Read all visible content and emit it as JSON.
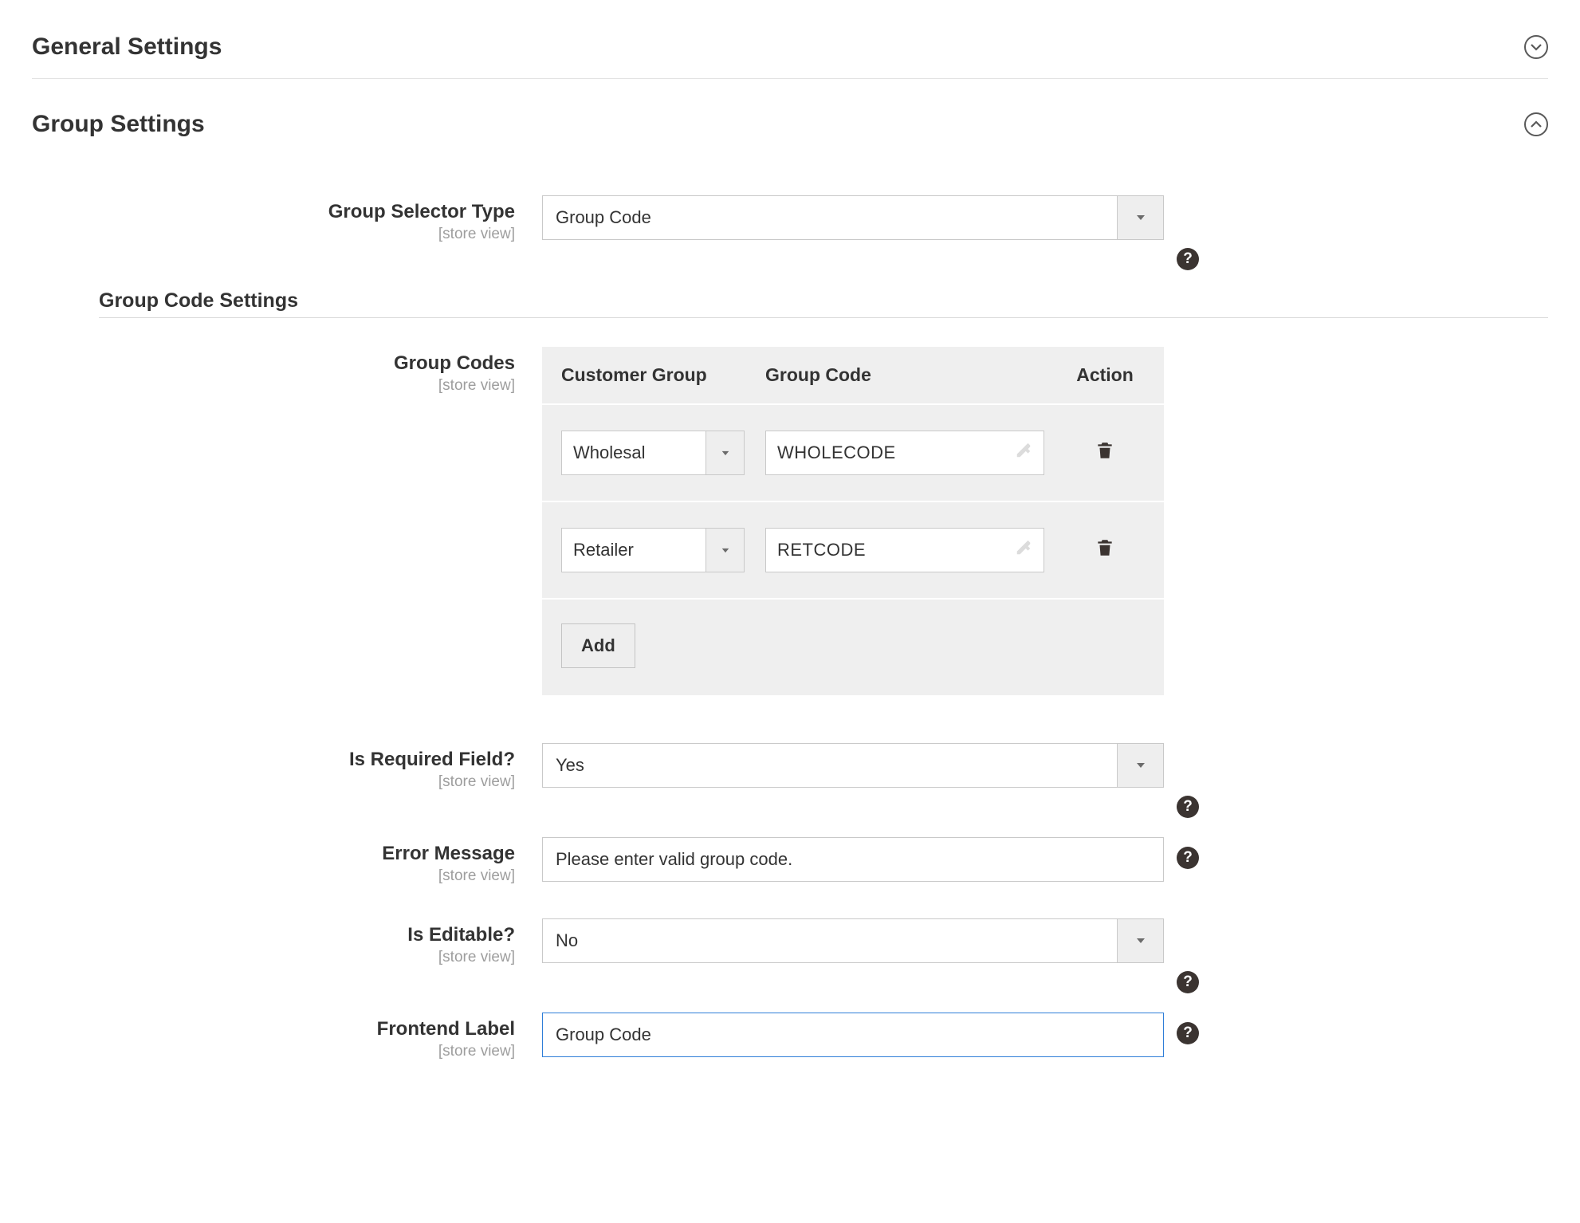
{
  "sections": {
    "general": {
      "title": "General Settings",
      "expanded": false
    },
    "group": {
      "title": "Group Settings",
      "expanded": true
    }
  },
  "scope_label": "[store view]",
  "fields": {
    "selector_type": {
      "label": "Group Selector Type",
      "value": "Group Code"
    },
    "subsection_title": "Group Code Settings",
    "codes": {
      "label": "Group Codes",
      "headers": {
        "group": "Customer Group",
        "code": "Group Code",
        "action": "Action"
      },
      "rows": [
        {
          "group": "Wholesal",
          "code": "WHOLECODE"
        },
        {
          "group": "Retailer",
          "code": "RETCODE"
        }
      ],
      "add_label": "Add"
    },
    "required": {
      "label": "Is Required Field?",
      "value": "Yes"
    },
    "error_msg": {
      "label": "Error Message",
      "value": "Please enter valid group code."
    },
    "editable": {
      "label": "Is Editable?",
      "value": "No"
    },
    "frontend": {
      "label": "Frontend Label",
      "value": "Group Code"
    }
  }
}
